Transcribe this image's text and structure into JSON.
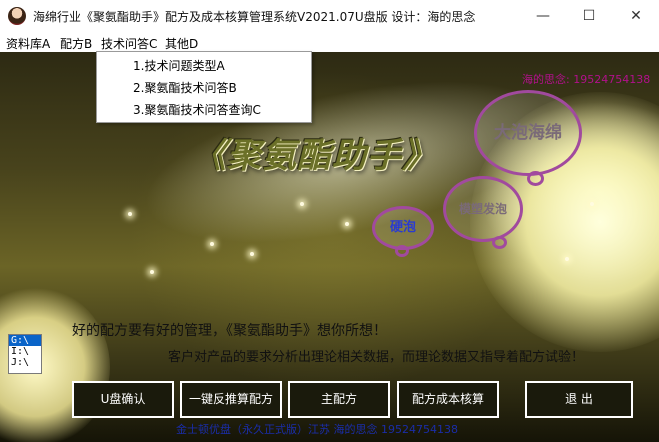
{
  "window": {
    "title": "海绵行业《聚氨酯助手》配方及成本核算管理系统V2021.07U盘版   设计：海的思念",
    "controls": {
      "minimize": "—",
      "maximize": "☐",
      "close": "✕"
    }
  },
  "menu": {
    "items": [
      {
        "label": "资料库A"
      },
      {
        "label": "配方B"
      },
      {
        "label": "技术问答C"
      },
      {
        "label": "其他D"
      }
    ]
  },
  "dropdown": {
    "items": [
      {
        "label": "1.技术问题类型A"
      },
      {
        "label": "2.聚氨酯技术问答B"
      },
      {
        "label": "3.聚氨酯技术问答查询C"
      }
    ]
  },
  "main": {
    "contact_top": "海的思念: 19524754138",
    "logo": "《聚氨酯助手》",
    "bubbles": {
      "large": "大泡海绵",
      "medium": "模塑发泡",
      "small": "硬泡"
    },
    "drives": [
      {
        "label": "G:\\",
        "selected": true
      },
      {
        "label": "I:\\",
        "selected": false
      },
      {
        "label": "J:\\",
        "selected": false
      }
    ],
    "slogan_line1": "好的配方要有好的管理，《聚氨酯助手》想你所想！",
    "slogan_line2": "客户对产品的要求分析出理论相关数据，而理论数据又指导着配方试验！",
    "buttons": {
      "usb_confirm": "U盘确认",
      "reverse_formula": "一键反推算配方",
      "main_formula": "主配方",
      "cost_accounting": "配方成本核算",
      "exit": "退  出"
    },
    "footer": "金士顿优盘（永久正式版）江苏   海的思念   19524754138"
  },
  "colors": {
    "bubble_border": "#a14a9e",
    "contact_text": "#b2108b",
    "footer_text": "#1a2da8",
    "button_bg": "#1a1a0c"
  }
}
